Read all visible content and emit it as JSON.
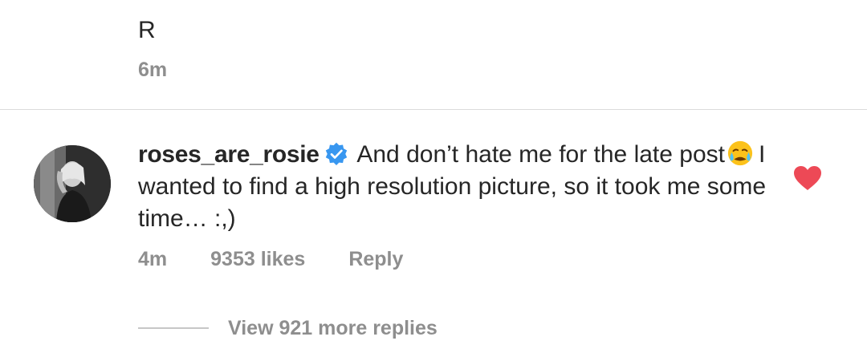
{
  "previous_comment": {
    "text": "R",
    "time": "6m"
  },
  "comment": {
    "username": "roses_are_rosie",
    "verified": true,
    "text_before_emoji": "And don’t hate me for the late post",
    "emoji": "sad-but-relieved-face-emoji",
    "text_after_emoji": "I wanted to find a high resolution picture, so it took me some time… :,)",
    "time": "4m",
    "likes": "9353 likes",
    "reply_label": "Reply",
    "liked": true
  },
  "replies": {
    "label": "View 921 more replies"
  },
  "colors": {
    "text": "#262626",
    "secondary": "#8e8e8e",
    "verified": "#3897f0",
    "heart": "#ed4956",
    "divider": "#dbdbdb"
  }
}
